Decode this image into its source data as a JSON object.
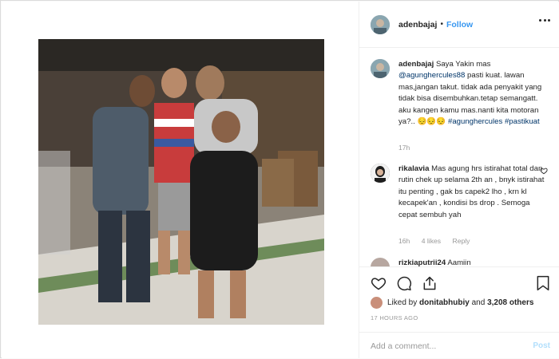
{
  "post": {
    "username": "adenbajaj",
    "separator": "•",
    "follow_label": "Follow",
    "more_icon": "more-horizontal-icon"
  },
  "caption": {
    "username": "adenbajaj",
    "text_before_mention": "Saya Yakin mas",
    "mention": "@agunghercules88",
    "text_after_mention": "pasti kuat. lawan mas,jangan takut. tidak ada penyakit yang tidak bisa disembuhkan.tetap semangatt. aku kangen kamu mas.nanti kita motoran ya?..",
    "emoji": "😔😔😔",
    "hashtag_1": "#agunghercules",
    "hashtag_2": "#pastikuat",
    "time": "17h"
  },
  "comments": [
    {
      "username": "rikalavia",
      "text": "Mas agung hrs istirahat total dan rutin chek up selama 2th an , bnyk istirahat itu penting , gak bs capek2 lho , krn kl kecapek'an , kondisi bs drop . Semoga cepat sembuh yah",
      "time": "16h",
      "likes": "4 likes",
      "reply": "Reply"
    },
    {
      "username": "rizkiaputrii24",
      "text": "Aamiin"
    }
  ],
  "actions": {
    "like_icon": "heart-icon",
    "comment_icon": "comment-icon",
    "share_icon": "share-icon",
    "save_icon": "bookmark-icon"
  },
  "likes": {
    "prefix": "Liked by",
    "user": "donitabhubiy",
    "and": "and",
    "others": "3,208 others"
  },
  "timestamp": "17 HOURS AGO",
  "add_comment": {
    "placeholder": "Add a comment...",
    "post_label": "Post"
  },
  "colors": {
    "link_blue": "#3897f0",
    "text": "#262626",
    "muted": "#999999",
    "border": "#dbdbdb"
  }
}
